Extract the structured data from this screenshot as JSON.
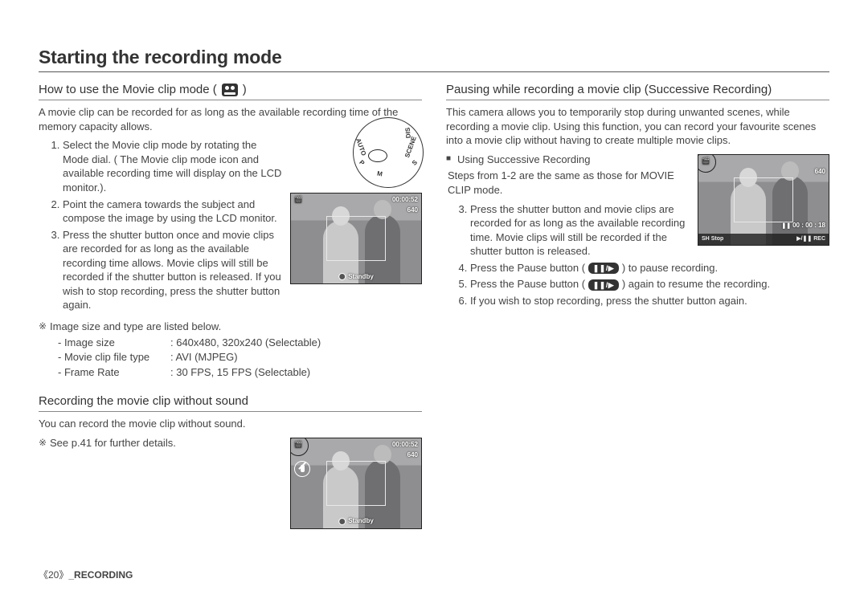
{
  "page_title": "Starting the recording mode",
  "left": {
    "heading1": "How to use the Movie clip mode (",
    "heading1_close": ")",
    "intro": "A movie clip can be recorded for as long as the available recording time of the memory capacity allows.",
    "step1": "Select the Movie clip mode by rotating the Mode dial. ( The Movie clip mode icon and available recording time will display on the LCD monitor.).",
    "step2": "Point the camera towards the subject and compose the image by using the LCD monitor.",
    "step3": "Press the shutter button once and movie clips are recorded for as long as the available recording time allows. Movie clips will still be recorded if the shutter button is released. If you wish to stop recording, press the shutter button again.",
    "specs_note": "Image size and type are listed below.",
    "spec_size_label": "- Image size",
    "spec_size_val": ": 640x480, 320x240 (Selectable)",
    "spec_type_label": "- Movie clip file type",
    "spec_type_val": ": AVI (MJPEG)",
    "spec_fps_label": "- Frame Rate",
    "spec_fps_val": ": 30 FPS, 15 FPS (Selectable)",
    "heading2": "Recording the movie clip without sound",
    "no_sound_intro": "You can record the movie clip without sound.",
    "no_sound_ref": "See p.41 for further details.",
    "dial": {
      "scene": "SCENE",
      "auto": "AUTO",
      "p": "P",
      "m": "M",
      "s": "S",
      "dis": "DIS"
    },
    "lcd_time": "00:00:52",
    "lcd_size": "640",
    "lcd_status": "Standby"
  },
  "right": {
    "heading": "Pausing while recording a movie clip (Successive Recording)",
    "intro": "This camera allows you to temporarily stop during unwanted scenes, while recording a movie clip. Using this function, you can record your favourite scenes into a movie clip without having to create multiple movie clips.",
    "sub": "Using Successive Recording",
    "same": "Steps from 1-2 are the same as those for MOVIE CLIP mode.",
    "step3": "Press the shutter button and movie clips are recorded for as long as the available recording time. Movie clips will still be recorded if the shutter button is released.",
    "step4a": "Press the Pause button (",
    "step4b": ") to pause recording.",
    "step5a": "Press the Pause button (",
    "step5b": ") again to resume the recording.",
    "step6": "If you wish to stop recording, press the shutter button again.",
    "btn_label": "❚❚/▶",
    "lcd_size": "640",
    "lcd_time": "00 : 00 : 18",
    "lcd_sh": "SH",
    "lcd_stop": "Stop",
    "lcd_rec_btn": "▶/❚❚",
    "lcd_rec": "REC"
  },
  "footer": {
    "page": "《20》",
    "section": "_RECORDING"
  }
}
